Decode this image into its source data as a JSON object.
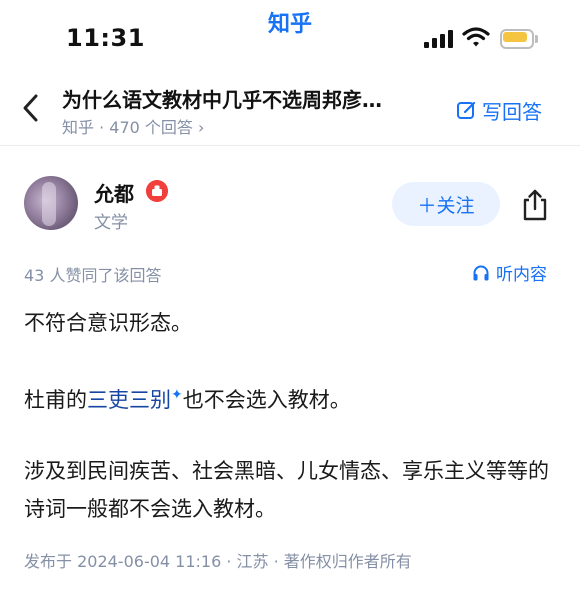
{
  "status_bar": {
    "time": "11:31",
    "brand": "知乎"
  },
  "nav": {
    "question_title": "为什么语文教材中几乎不选周邦彦…",
    "question_meta": "知乎 · 470 个回答 ›",
    "write_answer": "写回答"
  },
  "author": {
    "name": "允都",
    "tag": "文学",
    "follow_label": "＋关注"
  },
  "answer": {
    "vote_line": "43 人赞同了该回答",
    "listen_label": "听内容",
    "para_1": "不符合意识形态。",
    "para_2_prefix": "杜甫的",
    "para_2_keyword": "三吏三别",
    "para_2_suffix": "也不会选入教材。",
    "para_3": "涉及到民间疾苦、社会黑暗、儿女情态、享乐主义等等的诗词一般都不会选入教材。",
    "publish_info": "发布于 2024-06-04 11:16 · 江苏 · 著作权归作者所有"
  },
  "colors": {
    "brand_blue": "#1772f6",
    "meta_gray": "#8590a6",
    "keyword_blue": "#1746a2",
    "battery_yellow": "#f5c542"
  },
  "icons": {
    "back": "chevron-left-icon",
    "write": "edit-icon",
    "share": "share-icon",
    "listen": "headphones-icon",
    "badge": "creator-badge-icon"
  }
}
